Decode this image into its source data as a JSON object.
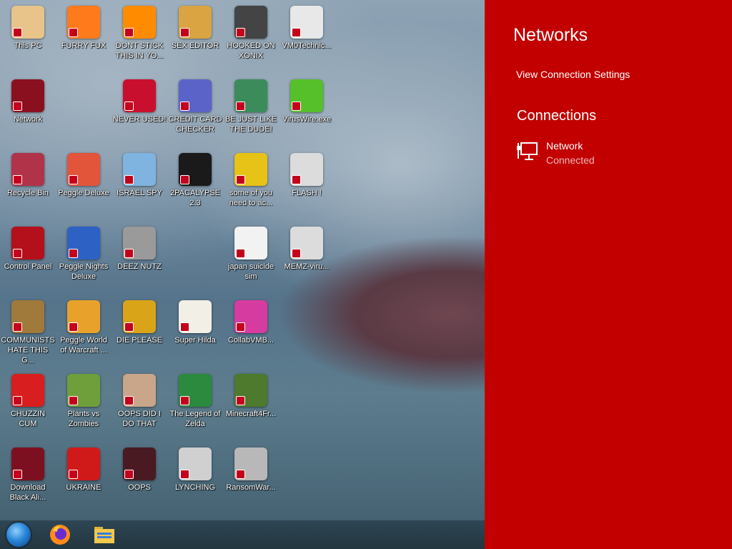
{
  "desktop": {
    "icons": [
      {
        "label": "This PC",
        "icon": "this-pc-icon",
        "color": "#e8c38a"
      },
      {
        "label": "FURRY FUX",
        "icon": "firefox-icon",
        "color": "#ff7a1a"
      },
      {
        "label": "DONT STICK THIS IN YO...",
        "icon": "vlc-cone-icon",
        "color": "#ff8c00"
      },
      {
        "label": "SEX EDITOR",
        "icon": "hxd-editor-icon",
        "color": "#d9a441"
      },
      {
        "label": "HOOKED ON XONIX",
        "icon": "xonix-icon",
        "color": "#444444"
      },
      {
        "label": "VM0Technic...",
        "icon": "doctor-icon",
        "color": "#e8e8e8"
      },
      {
        "label": "Network",
        "icon": "network-icon",
        "color": "#8a1020"
      },
      {
        "label": "NEVER USED!",
        "icon": "devcpp-icon",
        "color": "#c8102e"
      },
      {
        "label": "CREDIT CARD CHECKER",
        "icon": "credit-card-icon",
        "color": "#5b63c9"
      },
      {
        "label": "BE JUST LIKE THE DUDE!",
        "icon": "dude-icon",
        "color": "#3b8c5a"
      },
      {
        "label": "VirusWire.exe",
        "icon": "limewire-icon",
        "color": "#55c02a"
      },
      {
        "label": "Recycle Bin",
        "icon": "recycle-bin-icon",
        "color": "#b0334a"
      },
      {
        "label": "Peggle Deluxe",
        "icon": "peggle-icon",
        "color": "#e2553a"
      },
      {
        "label": "ISRAEL SPY",
        "icon": "spy-computer-icon",
        "color": "#7fb4e0"
      },
      {
        "label": "2PACALYPSE 2.3",
        "icon": "terminal-icon",
        "color": "#1a1a1a"
      },
      {
        "label": "some of you need to ac...",
        "icon": "dog-icon",
        "color": "#e7c217"
      },
      {
        "label": "FLASH !",
        "icon": "flash-file-icon",
        "color": "#dcdcdc"
      },
      {
        "label": "Control Panel",
        "icon": "control-panel-icon",
        "color": "#b3101c"
      },
      {
        "label": "Peggle Nights Deluxe",
        "icon": "peggle-nights-icon",
        "color": "#2d62c4"
      },
      {
        "label": "DEEZ NUTZ",
        "icon": "stacked-windows-icon",
        "color": "#9a9a9a"
      },
      {
        "label": "japan suicide sim",
        "icon": "japan-sim-icon",
        "color": "#f2f2f2"
      },
      {
        "label": "MEMZ-viru...",
        "icon": "memz-file-icon",
        "color": "#dcdcdc"
      },
      {
        "label": "COMMUNISTS HATE THIS G...",
        "icon": "money-bag-icon",
        "color": "#a07a3a"
      },
      {
        "label": "Peggle World of Warcraft ...",
        "icon": "peggle-wow-icon",
        "color": "#e8a22c"
      },
      {
        "label": "DIE PLEASE",
        "icon": "de-icon",
        "color": "#d9a417"
      },
      {
        "label": "Super Hilda",
        "icon": "pixel-art-icon",
        "color": "#f2efe6"
      },
      {
        "label": "CollabVMB...",
        "icon": "collabvm-icon",
        "color": "#d63ba0"
      },
      {
        "label": "CHUZZIN CUM",
        "icon": "chuzzle-icon",
        "color": "#d81e1e"
      },
      {
        "label": "Plants vs Zombies",
        "icon": "pvz-flower-icon",
        "color": "#6f9f3a"
      },
      {
        "label": "OOPS DID I DO THAT",
        "icon": "portrait-icon",
        "color": "#c9a58a"
      },
      {
        "label": "The Legend of Zelda",
        "icon": "pixel-hero-icon",
        "color": "#2c8a3f"
      },
      {
        "label": "Minecraft4Fr...",
        "icon": "minecraft-block-icon",
        "color": "#4d7a2c"
      },
      {
        "label": "Download Black Ali...",
        "icon": "red-orb-icon",
        "color": "#7d1020"
      },
      {
        "label": "UKRAINE",
        "icon": "radiation-icon",
        "color": "#d01a1a"
      },
      {
        "label": "OOPS",
        "icon": "dark-book-icon",
        "color": "#4a1a22"
      },
      {
        "label": "LYNCHING",
        "icon": "lynching-icon",
        "color": "#d0d0d0"
      },
      {
        "label": "RansomWar...",
        "icon": "skull-icon",
        "color": "#b8b8b8"
      }
    ]
  },
  "taskbar": {
    "items": [
      {
        "name": "start-orb",
        "icon": "start-orb-icon"
      },
      {
        "name": "taskbar-firefox",
        "icon": "firefox-icon"
      },
      {
        "name": "taskbar-file-explorer",
        "icon": "folder-icon"
      }
    ]
  },
  "networks_panel": {
    "title": "Networks",
    "view_settings_link": "View Connection Settings",
    "connections_heading": "Connections",
    "connection": {
      "name": "Network",
      "status": "Connected",
      "icon": "wired-network-icon"
    },
    "background_color": "#c20000"
  }
}
